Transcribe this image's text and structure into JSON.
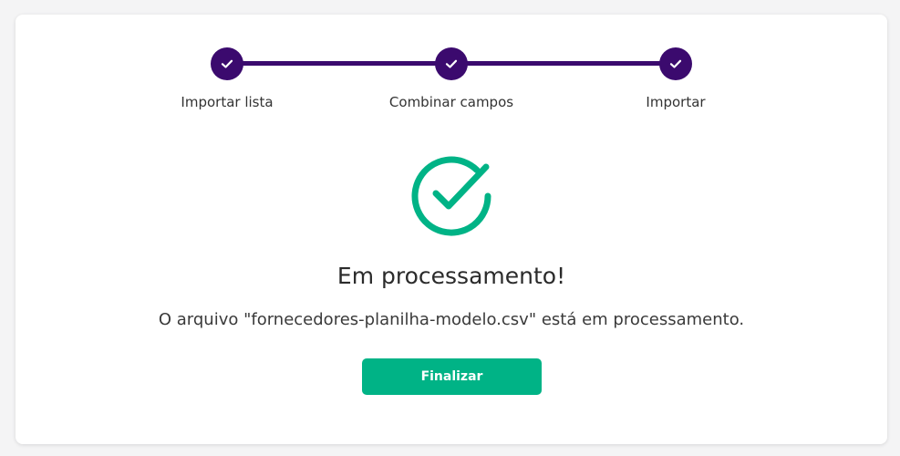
{
  "colors": {
    "page_background": "#f4f4f5",
    "card_background": "#ffffff",
    "step_accent": "#3b0a6e",
    "success_accent": "#00b386",
    "button_text": "#ffffff"
  },
  "stepper": {
    "steps": [
      {
        "label": "Importar lista",
        "status": "completed",
        "icon": "check-icon"
      },
      {
        "label": "Combinar campos",
        "status": "completed",
        "icon": "check-icon"
      },
      {
        "label": "Importar",
        "status": "completed",
        "icon": "check-icon"
      }
    ]
  },
  "result": {
    "icon": "success-check-circle-icon",
    "title": "Em processamento!",
    "message": "O arquivo \"fornecedores-planilha-modelo.csv\" está em processamento."
  },
  "actions": {
    "finish_label": "Finalizar"
  }
}
